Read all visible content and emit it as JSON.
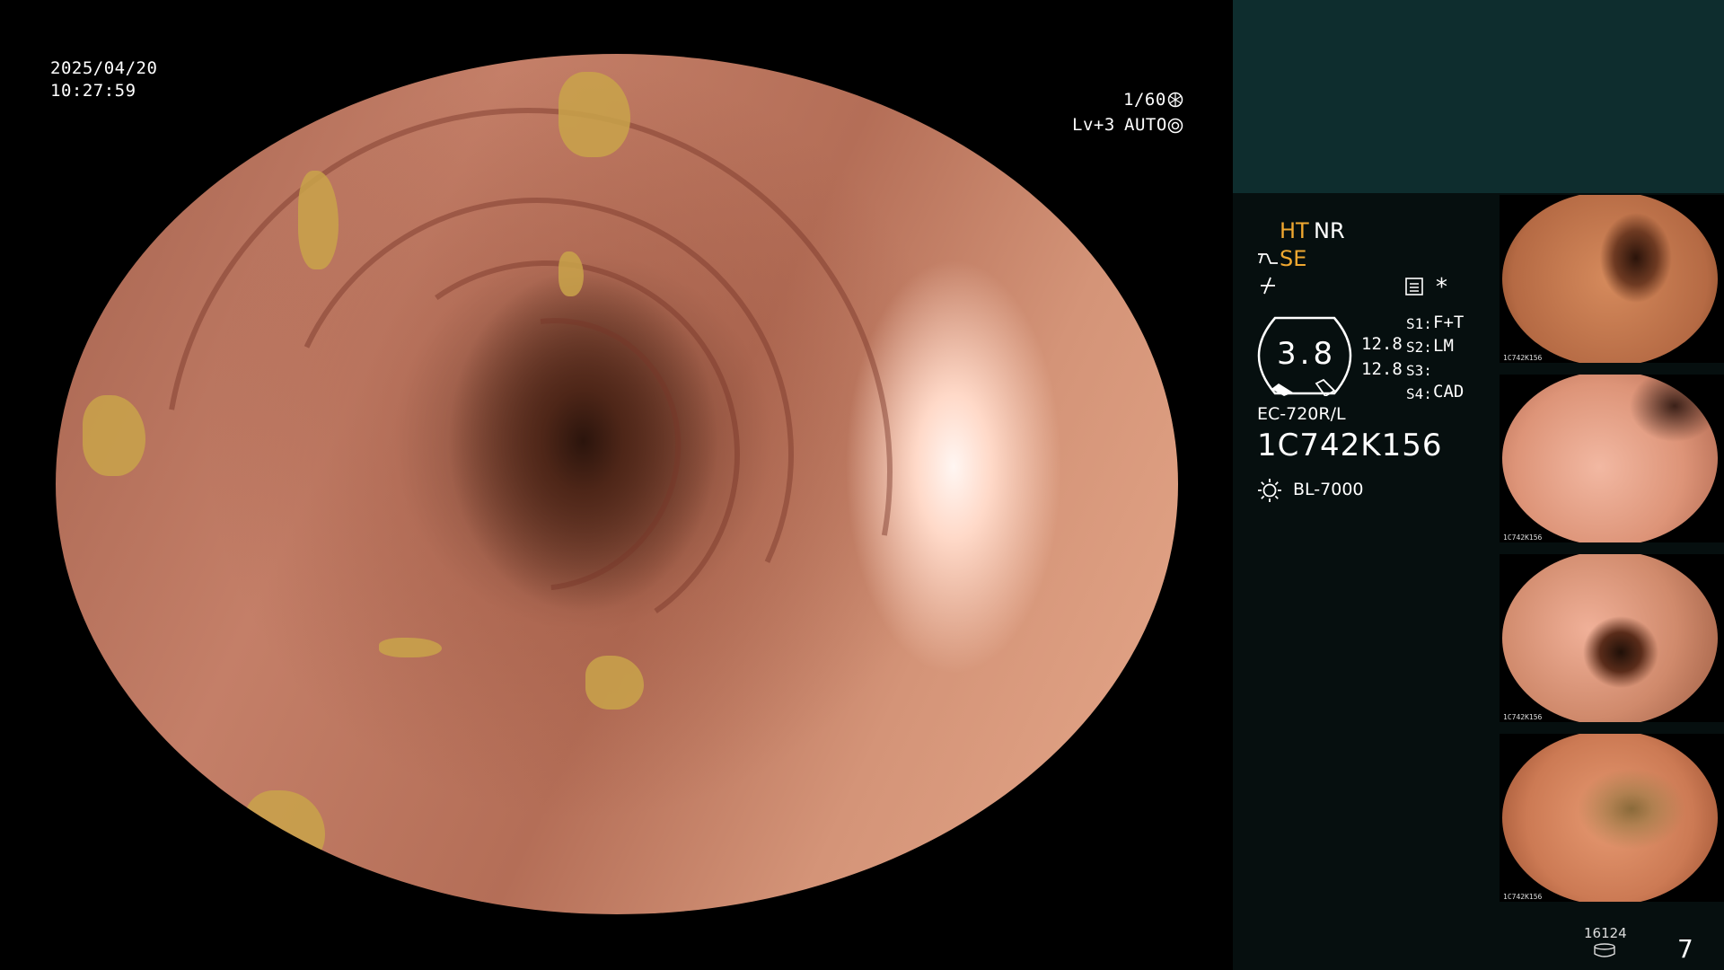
{
  "overlay": {
    "date": "2025/04/20",
    "time": "10:27:59",
    "shutter": "1/60",
    "level": "Lv+3",
    "mode": "AUTO"
  },
  "panel": {
    "ht": "HT",
    "nr": "NR",
    "se": "SE",
    "gauge_value": "3.8",
    "readout_a": "12.8",
    "readout_b": "12.8",
    "s1": {
      "key": "S1:",
      "val": "F+T"
    },
    "s2": {
      "key": "S2:",
      "val": "LM"
    },
    "s3": {
      "key": "S3:",
      "val": ""
    },
    "s4": {
      "key": "S4:",
      "val": "CAD"
    },
    "scope_model": "EC-720R/L",
    "scope_serial": "1C742K156",
    "light_source": "BL-7000",
    "storage_count": "16124",
    "image_count": "7",
    "star": "*"
  },
  "thumbnails": [
    {
      "label": "1C742K156"
    },
    {
      "label": "1C742K156"
    },
    {
      "label": "1C742K156"
    },
    {
      "label": "1C742K156"
    }
  ],
  "colors": {
    "accent_orange": "#f0a830",
    "panel_bg": "#060f0f",
    "panel_top_bg": "#0e2d2e"
  }
}
